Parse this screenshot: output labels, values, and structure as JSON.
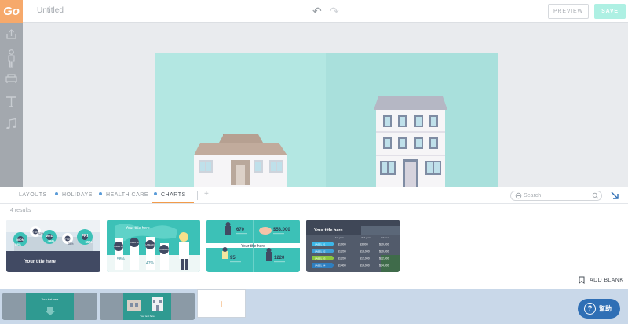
{
  "app": {
    "logo": "Go",
    "doc_title": "Untitled"
  },
  "toolbar": {
    "undo_icon": "↶",
    "redo_icon": "↷",
    "preview_label": "PREVIEW",
    "save_label": "SAVE"
  },
  "sidebar": {
    "items": [
      {
        "name": "upload-icon"
      },
      {
        "name": "character-icon"
      },
      {
        "name": "props-icon"
      },
      {
        "name": "text-icon"
      },
      {
        "name": "music-icon"
      }
    ]
  },
  "panel": {
    "tabs": [
      {
        "label": "LAYOUTS",
        "dot": false,
        "active": false
      },
      {
        "label": "HOLIDAYS",
        "dot": true,
        "active": false
      },
      {
        "label": "HEALTH CARE",
        "dot": true,
        "active": false
      },
      {
        "label": "CHARTS",
        "dot": true,
        "active": true
      }
    ],
    "add_tab": "+",
    "search_placeholder": "Search",
    "results": "4 results",
    "add_blank": "ADD BLANK"
  },
  "thumbnails": [
    {
      "title": "Your title here",
      "bubbles": [
        {
          "day": "MON",
          "value": "58%"
        },
        {
          "day": "TUE",
          "value": "32%"
        },
        {
          "day": "WED",
          "value": "46%"
        },
        {
          "day": "THUR",
          "value": "28%"
        },
        {
          "day": "FRI",
          "value": "65%"
        }
      ]
    },
    {
      "title": "Your title here",
      "labels": [
        "LABEL 01",
        "LABEL 02",
        "LABEL 03",
        "LABEL 04"
      ],
      "values": [
        "58%",
        "89%",
        "47%",
        "35%"
      ]
    },
    {
      "title": "Your title here",
      "stats": [
        "670",
        "$53,000",
        "95",
        "1220"
      ]
    },
    {
      "title": "Your title here",
      "columns": [
        "1st year",
        "2nd year",
        "3rd year"
      ],
      "rows": [
        {
          "label": "LABEL 01",
          "values": [
            "$1,000",
            "$3,000",
            "$20,000"
          ]
        },
        {
          "label": "LABEL 02",
          "values": [
            "$1,200",
            "$13,000",
            "$20,000"
          ]
        },
        {
          "label": "LABEL 03",
          "values": [
            "$1,200",
            "$12,000",
            "$22,000"
          ]
        },
        {
          "label": "LABEL 04",
          "values": [
            "$1,400",
            "$14,000",
            "$24,000"
          ]
        }
      ]
    }
  ],
  "strip": {
    "slides": [
      {
        "title": "Your text here"
      },
      {
        "title": "Your text here"
      }
    ],
    "add_slide": "+"
  },
  "help": {
    "label": "幫助",
    "icon": "?"
  },
  "colors": {
    "accent_orange": "#f29b4a",
    "teal": "#3cc1b7",
    "scene_bg": "#b3e7e2",
    "save_disabled": "#aef0e3",
    "help_blue": "#2f6fb5"
  }
}
